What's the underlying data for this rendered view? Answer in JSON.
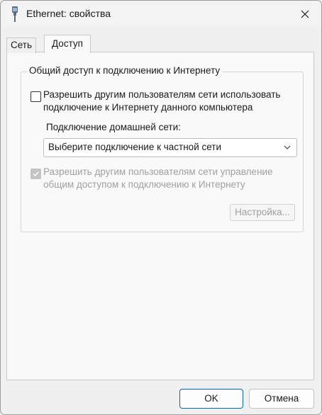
{
  "window": {
    "title": "Ethernet: свойства",
    "icon": "ethernet-icon"
  },
  "tabs": [
    {
      "label": "Сеть",
      "active": false
    },
    {
      "label": "Доступ",
      "active": true
    }
  ],
  "group": {
    "label": "Общий доступ к подключению к Интернету",
    "allow_sharing": {
      "checked": false,
      "line1": "Разрешить другим пользователям сети использовать",
      "line2": "подключение к Интернету данного компьютера"
    },
    "home_network_label": "Подключение домашней сети:",
    "home_network_select": {
      "value": "Выберите подключение к частной сети"
    },
    "allow_control": {
      "checked": true,
      "disabled": true,
      "line1": "Разрешить другим пользователям сети управление",
      "line2": "общим доступом к подключению к Интернету"
    },
    "settings_button": "Настройка..."
  },
  "footer": {
    "ok": "OK",
    "cancel": "Отмена"
  },
  "colors": {
    "accent": "#0067c0",
    "disabled_text": "#a0a0a0"
  }
}
